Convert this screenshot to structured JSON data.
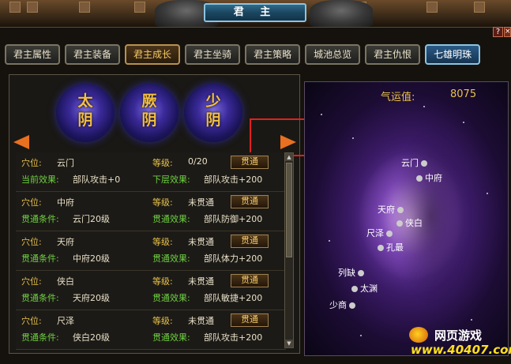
{
  "window": {
    "title": "君 主",
    "help_icon": "question-icon",
    "close_icon": "close-icon"
  },
  "tabs": [
    {
      "label": "君主属性",
      "state": "normal"
    },
    {
      "label": "君主装备",
      "state": "normal"
    },
    {
      "label": "君主成长",
      "state": "active"
    },
    {
      "label": "君主坐骑",
      "state": "normal"
    },
    {
      "label": "君主策略",
      "state": "normal"
    },
    {
      "label": "城池总览",
      "state": "normal"
    },
    {
      "label": "君主仇恨",
      "state": "normal"
    },
    {
      "label": "七雄明珠",
      "state": "special"
    }
  ],
  "meridians": [
    {
      "name": "太\n阴"
    },
    {
      "name": "厥\n阴"
    },
    {
      "name": "少\n阴"
    }
  ],
  "rows": [
    {
      "point_label": "穴位:",
      "point": "云门",
      "level_label": "等级:",
      "level": "0/20",
      "button": "贯通",
      "effect_label": "当前效果:",
      "effect": "部队攻击+0",
      "next_label": "下层效果:",
      "next": "部队攻击+200"
    },
    {
      "point_label": "穴位:",
      "point": "中府",
      "level_label": "等级:",
      "level": "未贯通",
      "button": "贯通",
      "effect_label": "贯通条件:",
      "effect": "云门20级",
      "next_label": "贯通效果:",
      "next": "部队防御+200"
    },
    {
      "point_label": "穴位:",
      "point": "天府",
      "level_label": "等级:",
      "level": "未贯通",
      "button": "贯通",
      "effect_label": "贯通条件:",
      "effect": "中府20级",
      "next_label": "贯通效果:",
      "next": "部队体力+200"
    },
    {
      "point_label": "穴位:",
      "point": "侠白",
      "level_label": "等级:",
      "level": "未贯通",
      "button": "贯通",
      "effect_label": "贯通条件:",
      "effect": "天府20级",
      "next_label": "贯通效果:",
      "next": "部队敏捷+200"
    },
    {
      "point_label": "穴位:",
      "point": "尺泽",
      "level_label": "等级:",
      "level": "未贯通",
      "button": "贯通",
      "effect_label": "贯通条件:",
      "effect": "侠白20级",
      "next_label": "贯通效果:",
      "next": "部队攻击+200"
    }
  ],
  "luck": {
    "label": "气运值:",
    "value": "8075"
  },
  "acupoints": [
    {
      "name": "云门",
      "side": "left"
    },
    {
      "name": "中府",
      "side": "right"
    },
    {
      "name": "天府",
      "side": "left"
    },
    {
      "name": "侠白",
      "side": "right"
    },
    {
      "name": "尺泽",
      "side": "left"
    },
    {
      "name": "孔最",
      "side": "right"
    },
    {
      "name": "列缺",
      "side": "left"
    },
    {
      "name": "太渊",
      "side": "right"
    },
    {
      "name": "少商",
      "side": "left"
    }
  ],
  "watermark": {
    "line1": "网页游戏",
    "line2": "www.40407.com"
  },
  "colors": {
    "accent_gold": "#e8c24a",
    "accent_green": "#6ed042",
    "arrow_orange": "#e87020",
    "highlight_red": "#e02020"
  }
}
